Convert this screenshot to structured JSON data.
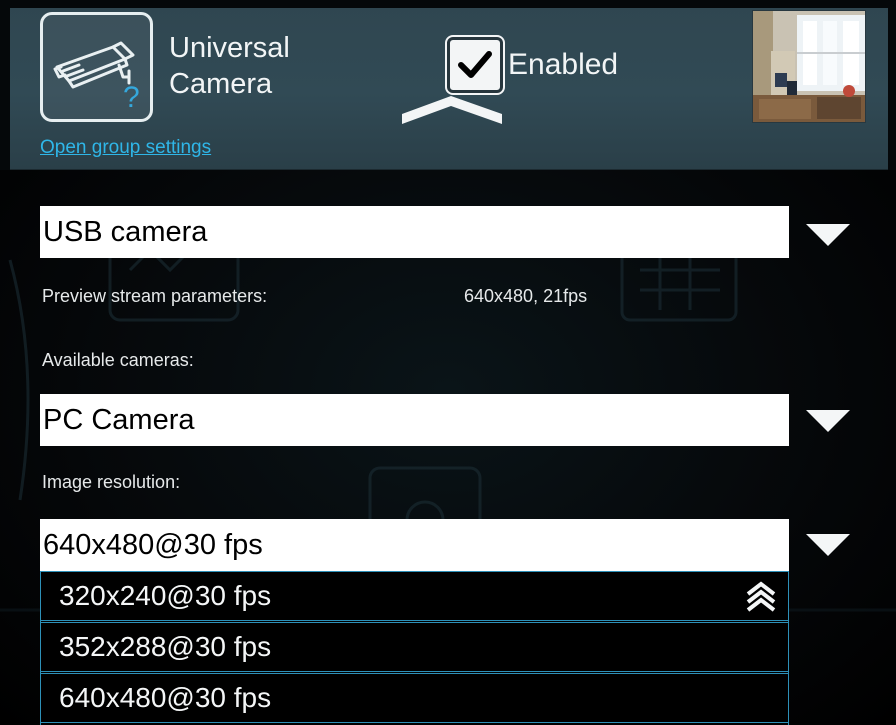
{
  "header": {
    "device_name_line1": "Universal",
    "device_name_line2": "Camera",
    "enabled_label": "Enabled",
    "enabled_checked": true,
    "open_group_link": "Open group settings"
  },
  "source_type": {
    "selected": "USB camera"
  },
  "preview": {
    "label": "Preview stream parameters:",
    "value": "640x480, 21fps"
  },
  "cameras": {
    "label": "Available cameras:",
    "selected": "PC Camera"
  },
  "resolution": {
    "label": "Image resolution:",
    "selected": "640x480@30 fps",
    "options": [
      "320x240@30 fps",
      "352x288@30 fps",
      "640x480@30 fps"
    ]
  },
  "colors": {
    "header_bg": "#314a55",
    "link": "#2fb6e8",
    "option_border": "#2d90b8"
  },
  "icons": {
    "device": "security-camera-icon",
    "dropdown": "triangle-down-icon",
    "scroll_up": "double-chevron-up-icon"
  }
}
